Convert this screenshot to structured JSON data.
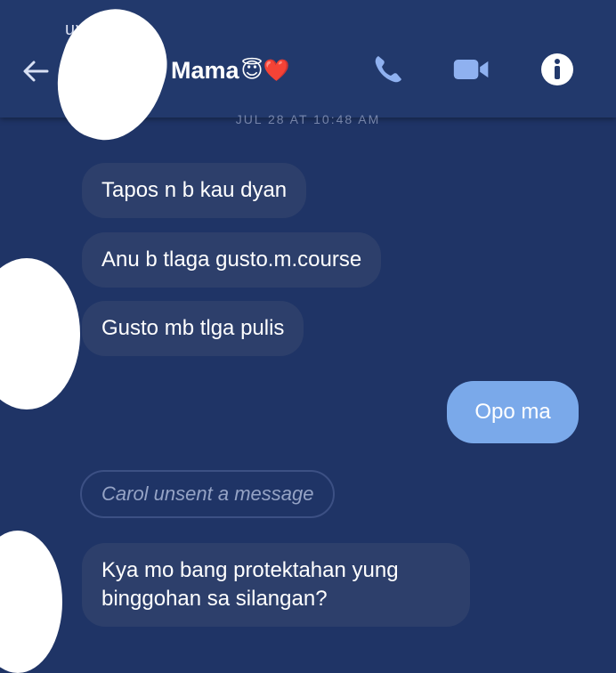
{
  "status": {
    "text": "uv"
  },
  "header": {
    "back_label": "←",
    "title": "Mama",
    "title_emojis": "😇❤️",
    "icons": {
      "call": "phone-icon",
      "video": "video-camera-icon",
      "info": "info-icon"
    }
  },
  "thread": {
    "timestamp": "JUL 28 AT 10:48 AM",
    "messages": [
      {
        "direction": "received",
        "text": "Tapos n  b kau dyan"
      },
      {
        "direction": "received",
        "text": "Anu b tlaga gusto.m.course"
      },
      {
        "direction": "received",
        "text": "Gusto mb tlga pulis"
      },
      {
        "direction": "sent",
        "text": "Opo ma"
      },
      {
        "direction": "received",
        "unsent": true,
        "text": "Carol unsent a message"
      },
      {
        "direction": "received",
        "text": "Kya mo bang protektahan yung binggohan sa silangan?"
      }
    ]
  },
  "colors": {
    "background": "#1f3466",
    "received_bubble": "#2d3f6b",
    "sent_bubble": "#7aa9ea"
  }
}
